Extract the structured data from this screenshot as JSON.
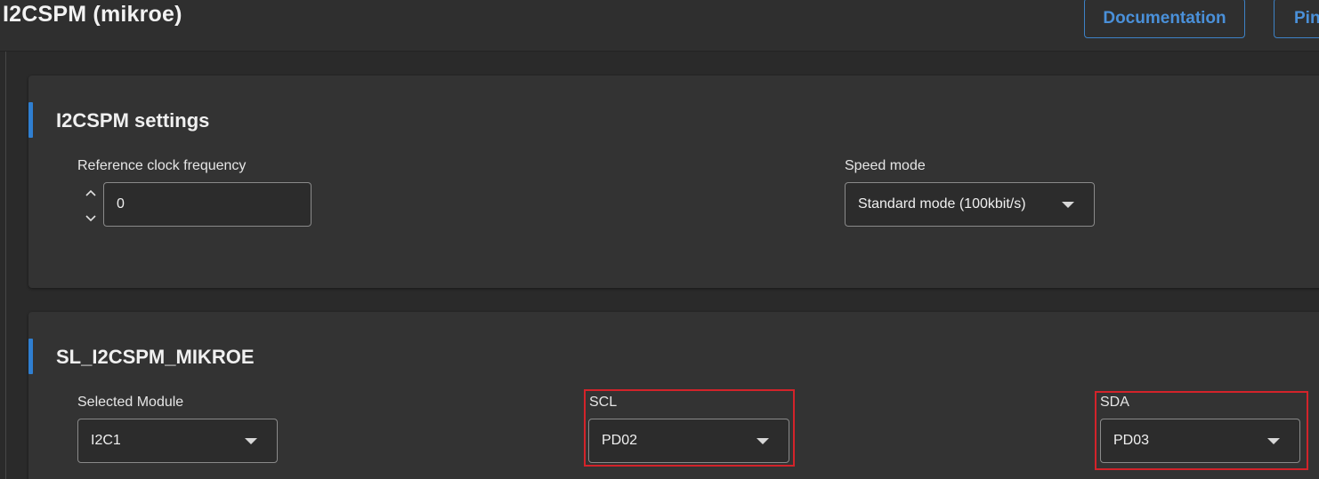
{
  "header": {
    "title": "I2CSPM (mikroe)",
    "documentation_label": "Documentation",
    "pin_label": "Pin"
  },
  "settings_card": {
    "title": "I2CSPM settings",
    "ref_clock": {
      "label": "Reference clock frequency",
      "value": "0"
    },
    "speed_mode": {
      "label": "Speed mode",
      "value": "Standard mode (100kbit/s)"
    }
  },
  "instance_card": {
    "title": "SL_I2CSPM_MIKROE",
    "module": {
      "label": "Selected Module",
      "value": "I2C1"
    },
    "scl": {
      "label": "SCL",
      "value": "PD02"
    },
    "sda": {
      "label": "SDA",
      "value": "PD03"
    }
  },
  "colors": {
    "accent": "#2f7fd1",
    "highlight": "#d3232a",
    "button": "#4a90d9"
  }
}
